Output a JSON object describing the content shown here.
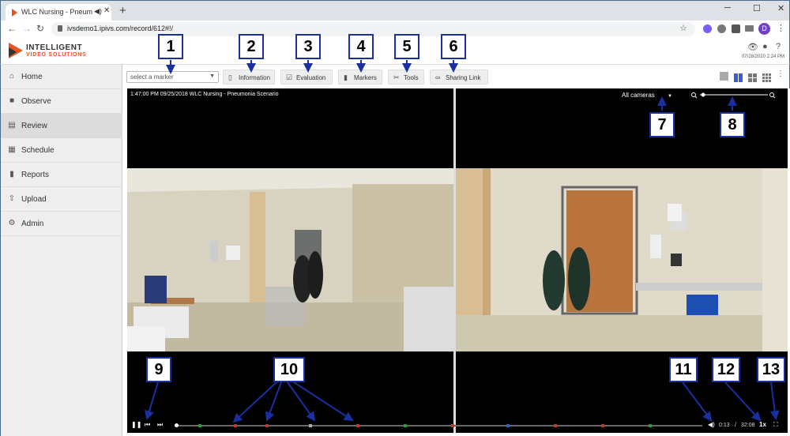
{
  "browser": {
    "tab_title": "WLC Nursing - Pneumonia S",
    "url": "ivsdemo1.ipivs.com/record/612#!/",
    "profile_initial": "D"
  },
  "app": {
    "logo_line1": "INTELLIGENT",
    "logo_line2": "VIDEO SOLUTIONS",
    "header_date": "07/28/2020 2:24 PM"
  },
  "sidebar": {
    "items": [
      {
        "label": "Home",
        "icon": "home-icon"
      },
      {
        "label": "Observe",
        "icon": "video-camera-icon"
      },
      {
        "label": "Review",
        "icon": "film-icon"
      },
      {
        "label": "Schedule",
        "icon": "calendar-icon"
      },
      {
        "label": "Reports",
        "icon": "bar-chart-icon"
      },
      {
        "label": "Upload",
        "icon": "upload-icon"
      },
      {
        "label": "Admin",
        "icon": "gear-icon"
      }
    ],
    "active_index": 2
  },
  "toolbar": {
    "marker_placeholder": "select a marker",
    "buttons": [
      {
        "label": "Information",
        "icon": "document-icon"
      },
      {
        "label": "Evaluation",
        "icon": "checkbox-icon"
      },
      {
        "label": "Markers",
        "icon": "bookmark-icon"
      },
      {
        "label": "Tools",
        "icon": "scissors-icon"
      },
      {
        "label": "Sharing Link",
        "icon": "link-icon"
      }
    ]
  },
  "video": {
    "overlay_title": "1:47:00 PM 09/25/2018 WLC Nursing - Pneumonia Scenario",
    "camera_select": "All cameras",
    "current_time": "0:13",
    "time_separator": "/",
    "duration": "32:08",
    "speed": "1x"
  },
  "callouts": [
    "1",
    "2",
    "3",
    "4",
    "5",
    "6",
    "7",
    "8",
    "9",
    "10",
    "11",
    "12",
    "13"
  ],
  "colors": {
    "brand_orange": "#e8541c",
    "callout_border": "#1a2fa0",
    "layout_active": "#3b5bdb"
  }
}
